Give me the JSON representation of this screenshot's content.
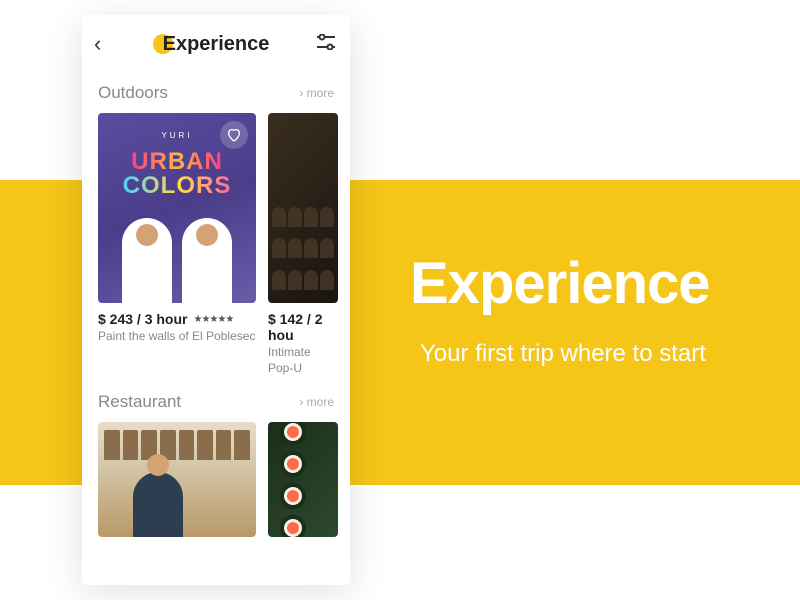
{
  "hero": {
    "title": "Experience",
    "subtitle": "Your first trip where to start"
  },
  "header": {
    "title": "Experience"
  },
  "sections": {
    "outdoors": {
      "title": "Outdoors",
      "more": "› more",
      "cards": [
        {
          "brand": "YURI",
          "line1": "URBAN",
          "line2": "COLORS",
          "price": "$ 243 / 3 hour",
          "stars": "★★★★★",
          "desc": "Paint the walls of El Poblesec"
        },
        {
          "price": "$ 142 / 2 hou",
          "desc": "Intimate Pop-U"
        }
      ]
    },
    "restaurant": {
      "title": "Restaurant",
      "more": "› more"
    }
  }
}
